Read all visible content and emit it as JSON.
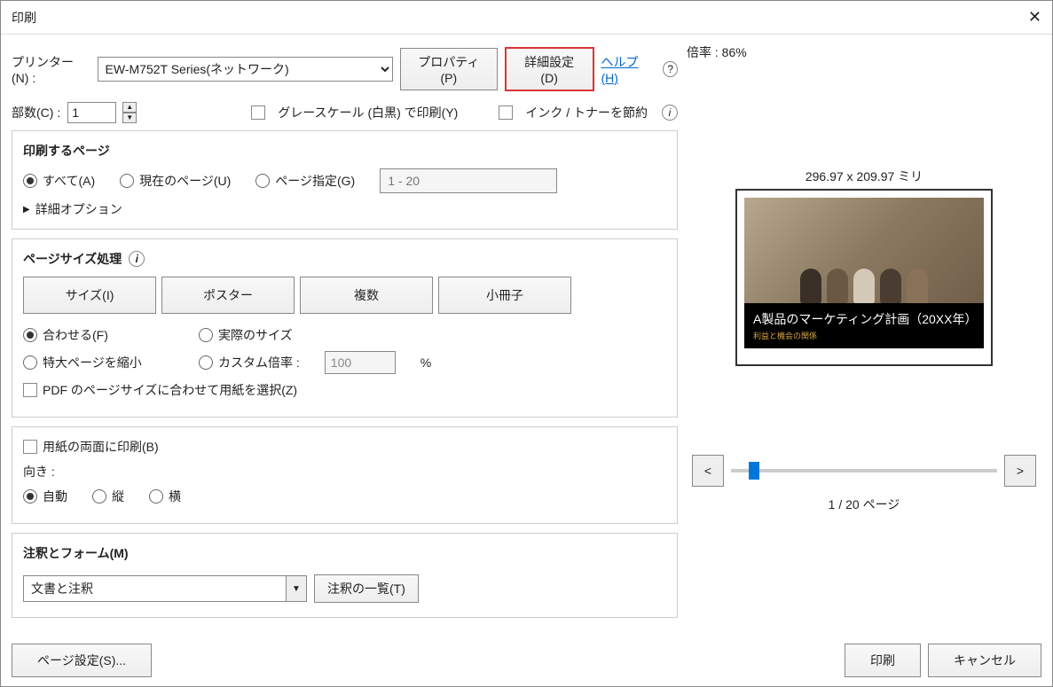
{
  "title": "印刷",
  "printerLabel": "プリンター(N) :",
  "printerValue": "EW-M752T Series(ネットワーク)",
  "propertiesBtn": "プロパティ(P)",
  "advancedBtn": "詳細設定(D)",
  "helpLink": "ヘルプ(H)",
  "copiesLabel": "部数(C) :",
  "copiesValue": "1",
  "grayscaleLabel": "グレースケール (白黒) で印刷(Y)",
  "saveInkLabel": "インク / トナーを節約",
  "pagesSection": {
    "title": "印刷するページ",
    "all": "すべて(A)",
    "current": "現在のページ(U)",
    "range": "ページ指定(G)",
    "rangePlaceholder": "1 - 20",
    "detailOptions": "詳細オプション"
  },
  "sizeSection": {
    "title": "ページサイズ処理",
    "tabs": {
      "size": "サイズ(I)",
      "poster": "ポスター",
      "multiple": "複数",
      "booklet": "小冊子"
    },
    "fit": "合わせる(F)",
    "actual": "実際のサイズ",
    "shrink": "特大ページを縮小",
    "custom": "カスタム倍率 :",
    "customValue": "100",
    "pct": "%",
    "pdfSize": "PDF のページサイズに合わせて用紙を選択(Z)"
  },
  "duplexLabel": "用紙の両面に印刷(B)",
  "orientation": {
    "title": "向き :",
    "auto": "自動",
    "portrait": "縦",
    "landscape": "横"
  },
  "comments": {
    "title": "注釈とフォーム(M)",
    "value": "文書と注釈",
    "listBtn": "注釈の一覧(T)"
  },
  "zoomLabel": "倍率 :",
  "zoomValue": "86%",
  "dims": "296.97 x 209.97 ミリ",
  "slideTitle": "A製品のマーケティング計画（20XX年）",
  "slideSub": "利益と機会の関係",
  "navPrev": "<",
  "navNext": ">",
  "pageIndicator": "1 / 20 ページ",
  "pageSetupBtn": "ページ設定(S)...",
  "printBtn": "印刷",
  "cancelBtn": "キャンセル"
}
